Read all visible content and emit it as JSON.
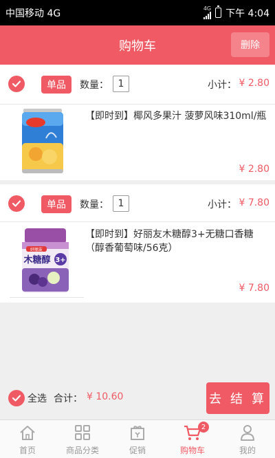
{
  "status_bar": {
    "carrier": "中国移动 4G",
    "signal_top": "4G",
    "time": "下午 4:04"
  },
  "header": {
    "title": "购物车",
    "delete_label": "删除"
  },
  "items": [
    {
      "tag": "单品",
      "qty_label": "数量：",
      "qty": "1",
      "subtotal_label": "小计：",
      "subtotal": "¥ 2.80",
      "name": "【即时到】椰风多果汁 菠萝风味310ml/瓶",
      "price": "¥ 2.80",
      "image_icon": "juice-can"
    },
    {
      "tag": "单品",
      "qty_label": "数量：",
      "qty": "1",
      "subtotal_label": "小计：",
      "subtotal": "¥ 7.80",
      "name": "【即时到】好丽友木糖醇3+无糖口香糖（醇香葡萄味/56克）",
      "price": "¥ 7.80",
      "image_icon": "gum-jar",
      "image_brand": "好丽友",
      "image_text": "木糖醇",
      "image_badge": "3+"
    }
  ],
  "footer": {
    "select_all": "全选",
    "total_label": "合计：",
    "total": "¥ 10.60",
    "checkout": "去 结 算"
  },
  "tabbar": {
    "tabs": [
      {
        "label": "首页",
        "icon": "home-icon"
      },
      {
        "label": "商品分类",
        "icon": "grid-icon"
      },
      {
        "label": "促销",
        "icon": "gift-icon"
      },
      {
        "label": "购物车",
        "icon": "cart-icon",
        "badge": "2"
      },
      {
        "label": "我的",
        "icon": "person-icon"
      }
    ],
    "active_index": 3
  },
  "colors": {
    "accent": "#f05a64",
    "background": "#efefef"
  }
}
